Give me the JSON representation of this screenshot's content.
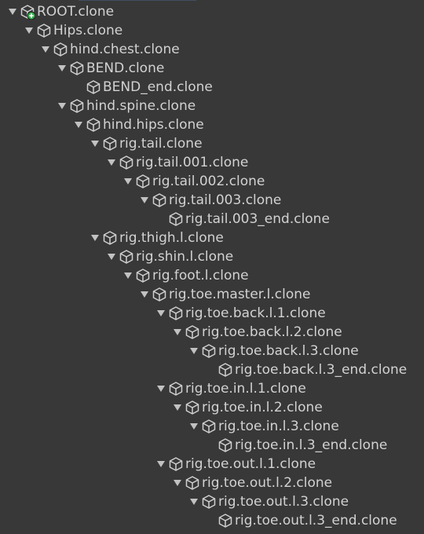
{
  "hierarchy": {
    "items": [
      {
        "label": "ROOT.clone",
        "depth": 0,
        "expanded": true,
        "icon": "prefab-add-icon"
      },
      {
        "label": "Hips.clone",
        "depth": 1,
        "expanded": true,
        "icon": "gameobject-icon"
      },
      {
        "label": "hind.chest.clone",
        "depth": 2,
        "expanded": true,
        "icon": "gameobject-icon"
      },
      {
        "label": "BEND.clone",
        "depth": 3,
        "expanded": true,
        "icon": "gameobject-icon"
      },
      {
        "label": "BEND_end.clone",
        "depth": 4,
        "expanded": null,
        "icon": "gameobject-icon"
      },
      {
        "label": "hind.spine.clone",
        "depth": 3,
        "expanded": true,
        "icon": "gameobject-icon"
      },
      {
        "label": "hind.hips.clone",
        "depth": 4,
        "expanded": true,
        "icon": "gameobject-icon"
      },
      {
        "label": "rig.tail.clone",
        "depth": 5,
        "expanded": true,
        "icon": "gameobject-icon"
      },
      {
        "label": "rig.tail.001.clone",
        "depth": 6,
        "expanded": true,
        "icon": "gameobject-icon"
      },
      {
        "label": "rig.tail.002.clone",
        "depth": 7,
        "expanded": true,
        "icon": "gameobject-icon"
      },
      {
        "label": "rig.tail.003.clone",
        "depth": 8,
        "expanded": true,
        "icon": "gameobject-icon"
      },
      {
        "label": "rig.tail.003_end.clone",
        "depth": 9,
        "expanded": null,
        "icon": "gameobject-icon"
      },
      {
        "label": "rig.thigh.l.clone",
        "depth": 5,
        "expanded": true,
        "icon": "gameobject-icon"
      },
      {
        "label": "rig.shin.l.clone",
        "depth": 6,
        "expanded": true,
        "icon": "gameobject-icon"
      },
      {
        "label": "rig.foot.l.clone",
        "depth": 7,
        "expanded": true,
        "icon": "gameobject-icon"
      },
      {
        "label": "rig.toe.master.l.clone",
        "depth": 8,
        "expanded": true,
        "icon": "gameobject-icon"
      },
      {
        "label": "rig.toe.back.l.1.clone",
        "depth": 9,
        "expanded": true,
        "icon": "gameobject-icon"
      },
      {
        "label": "rig.toe.back.l.2.clone",
        "depth": 10,
        "expanded": true,
        "icon": "gameobject-icon"
      },
      {
        "label": "rig.toe.back.l.3.clone",
        "depth": 11,
        "expanded": true,
        "icon": "gameobject-icon"
      },
      {
        "label": "rig.toe.back.l.3_end.clone",
        "depth": 12,
        "expanded": null,
        "icon": "gameobject-icon"
      },
      {
        "label": "rig.toe.in.l.1.clone",
        "depth": 9,
        "expanded": true,
        "icon": "gameobject-icon"
      },
      {
        "label": "rig.toe.in.l.2.clone",
        "depth": 10,
        "expanded": true,
        "icon": "gameobject-icon"
      },
      {
        "label": "rig.toe.in.l.3.clone",
        "depth": 11,
        "expanded": true,
        "icon": "gameobject-icon"
      },
      {
        "label": "rig.toe.in.l.3_end.clone",
        "depth": 12,
        "expanded": null,
        "icon": "gameobject-icon"
      },
      {
        "label": "rig.toe.out.l.1.clone",
        "depth": 9,
        "expanded": true,
        "icon": "gameobject-icon"
      },
      {
        "label": "rig.toe.out.l.2.clone",
        "depth": 10,
        "expanded": true,
        "icon": "gameobject-icon"
      },
      {
        "label": "rig.toe.out.l.3.clone",
        "depth": 11,
        "expanded": true,
        "icon": "gameobject-icon"
      },
      {
        "label": "rig.toe.out.l.3_end.clone",
        "depth": 12,
        "expanded": null,
        "icon": "gameobject-icon"
      }
    ]
  },
  "colors": {
    "background": "#383838",
    "text": "#d2d2d2",
    "arrow": "#c2c2c2",
    "icon": "#d0d0d0",
    "add_badge": "#33b24a"
  }
}
